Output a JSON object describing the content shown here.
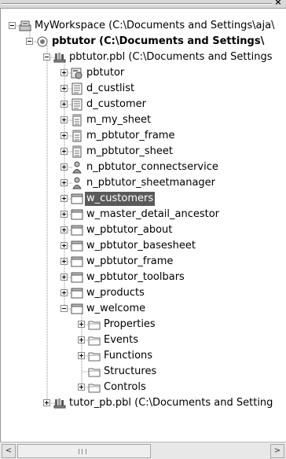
{
  "window": {
    "close_glyph": "×"
  },
  "tree": {
    "rows": [
      {
        "label": "MyWorkspace (C:\\Documents and Settings\\aja\\",
        "icon": "workspace-icon",
        "expanded": true,
        "depth": 0
      },
      {
        "label": "pbtutor (C:\\Documents and Settings\\",
        "icon": "target-icon",
        "expanded": true,
        "bold": true,
        "depth": 1
      },
      {
        "label": "pbtutor.pbl (C:\\Documents and Settings",
        "icon": "library-icon",
        "expanded": true,
        "depth": 2
      },
      {
        "label": "pbtutor",
        "icon": "application-icon",
        "expanded": false,
        "depth": 3
      },
      {
        "label": "d_custlist",
        "icon": "datawindow-icon",
        "expanded": false,
        "depth": 3
      },
      {
        "label": "d_customer",
        "icon": "datawindow-icon",
        "expanded": false,
        "depth": 3
      },
      {
        "label": "m_my_sheet",
        "icon": "menu-icon",
        "expanded": false,
        "depth": 3
      },
      {
        "label": "m_pbtutor_frame",
        "icon": "menu-icon",
        "expanded": false,
        "depth": 3
      },
      {
        "label": "m_pbtutor_sheet",
        "icon": "menu-icon",
        "expanded": false,
        "depth": 3
      },
      {
        "label": "n_pbtutor_connectservice",
        "icon": "userobject-icon",
        "expanded": false,
        "depth": 3
      },
      {
        "label": "n_pbtutor_sheetmanager",
        "icon": "userobject-icon",
        "expanded": false,
        "depth": 3
      },
      {
        "label": "w_customers",
        "icon": "window-icon",
        "expanded": false,
        "selected": true,
        "depth": 3
      },
      {
        "label": "w_master_detail_ancestor",
        "icon": "window-icon",
        "expanded": false,
        "depth": 3
      },
      {
        "label": "w_pbtutor_about",
        "icon": "window-icon",
        "expanded": false,
        "depth": 3
      },
      {
        "label": "w_pbtutor_basesheet",
        "icon": "window-icon",
        "expanded": false,
        "depth": 3
      },
      {
        "label": "w_pbtutor_frame",
        "icon": "window-icon",
        "expanded": false,
        "depth": 3
      },
      {
        "label": "w_pbtutor_toolbars",
        "icon": "window-icon",
        "expanded": false,
        "depth": 3
      },
      {
        "label": "w_products",
        "icon": "window-icon",
        "expanded": false,
        "depth": 3
      },
      {
        "label": "w_welcome",
        "icon": "window-icon",
        "expanded": true,
        "depth": 3
      },
      {
        "label": "Properties",
        "icon": "folder-icon",
        "expanded": false,
        "depth": 4
      },
      {
        "label": "Events",
        "icon": "folder-icon",
        "expanded": false,
        "depth": 4
      },
      {
        "label": "Functions",
        "icon": "folder-icon",
        "expanded": false,
        "depth": 4
      },
      {
        "label": "Structures",
        "icon": "folder-icon",
        "expanded": null,
        "depth": 4
      },
      {
        "label": "Controls",
        "icon": "folder-icon",
        "expanded": false,
        "depth": 4
      },
      {
        "label": "tutor_pb.pbl (C:\\Documents and Setting",
        "icon": "library-icon",
        "expanded": false,
        "depth": 2
      }
    ]
  },
  "scrollbar": {
    "left_glyph": "<",
    "right_glyph": ">"
  },
  "colors": {
    "selection": "#5a5a5a",
    "background": "#ffffff",
    "chrome": "#d8d8d8"
  }
}
